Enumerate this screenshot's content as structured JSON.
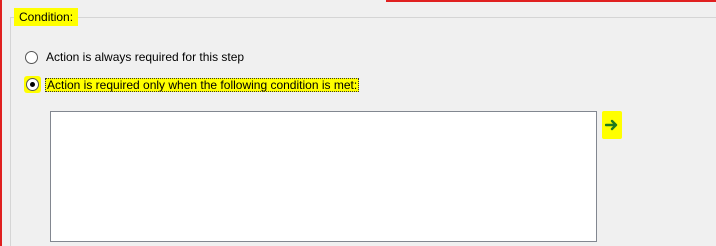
{
  "group": {
    "legend": "Condition:"
  },
  "options": [
    {
      "label": "Action is always required for this step",
      "checked": false
    },
    {
      "label": "Action is required only when the following condition is met:",
      "checked": true
    }
  ],
  "condition_input": {
    "value": ""
  },
  "arrow_button": {
    "icon": "arrow-right-icon"
  },
  "colors": {
    "highlight": "#ffff00",
    "arrow": "#1e7a1e",
    "frame": "#e02020"
  }
}
